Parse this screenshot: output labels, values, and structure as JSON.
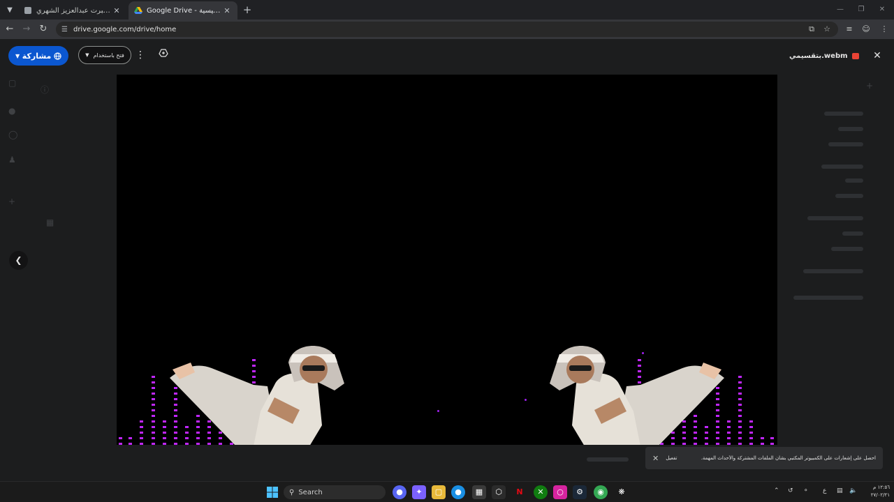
{
  "browser": {
    "tabs": [
      {
        "title": "البرت عبدالعزيز الشهري - Alert",
        "active": false
      },
      {
        "title": "Google Drive - الصفحة الرئيسية",
        "active": true
      }
    ],
    "url": "drive.google.com/drive/home"
  },
  "viewer": {
    "share_label": "مشاركة",
    "open_with_label": "فتح باستخدام",
    "file_name": "بتقسيمي.webm"
  },
  "toast": {
    "message": "احصل على إشعارات على الكمبيوتر المكتبي بشأن الملفات المشتركة والأحداث المهمة.",
    "action_label": "تفعيل"
  },
  "taskbar": {
    "search_label": "Search",
    "clock_time": "١٢:٥٦ م",
    "clock_date": "٢٧/٠٢/٢١",
    "tray_lang": "ع"
  },
  "colors": {
    "accent": "#0b57d0",
    "equalizer": "#c026ff",
    "background": "#1c1d1e"
  }
}
